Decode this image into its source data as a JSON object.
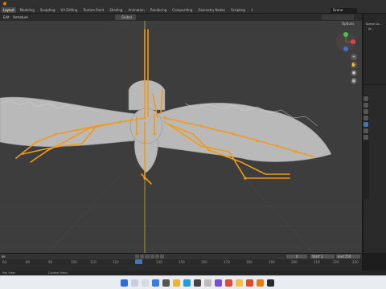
{
  "menu": {
    "items": [
      "Layout",
      "Modeling",
      "Sculpting",
      "UV Editing",
      "Texture Paint",
      "Shading",
      "Animation",
      "Rendering",
      "Compositing",
      "Geometry Nodes",
      "Scripting",
      "+"
    ],
    "active": "Layout"
  },
  "scene_label": "Scene",
  "viewport_header": {
    "mode": "Edit",
    "object": "Armature",
    "orientation": "Global",
    "options": "Options"
  },
  "timeline": {
    "ticks": [
      "60",
      "80",
      "90",
      "100",
      "110",
      "120",
      "130",
      "140",
      "150",
      "160",
      "170",
      "180",
      "190",
      "200",
      "210",
      "220",
      "230",
      "240",
      "250"
    ],
    "start_label": "Start",
    "start_value": "1",
    "end_label": "End",
    "end_value": "250",
    "frame_value": "0",
    "left_value": "ke"
  },
  "status": {
    "left": "Pan View",
    "middle": "Context Menu"
  },
  "outliner": {
    "row1": "Scene Co...",
    "row2": "Ar..."
  },
  "colors": {
    "bone": "#f29a1a",
    "accent": "#4772b3",
    "viewport_bg": "#3d3d3d"
  },
  "icons": [
    "search-icon",
    "widgets-icon",
    "edge-icon",
    "chrome-icon",
    "blender-icon"
  ]
}
